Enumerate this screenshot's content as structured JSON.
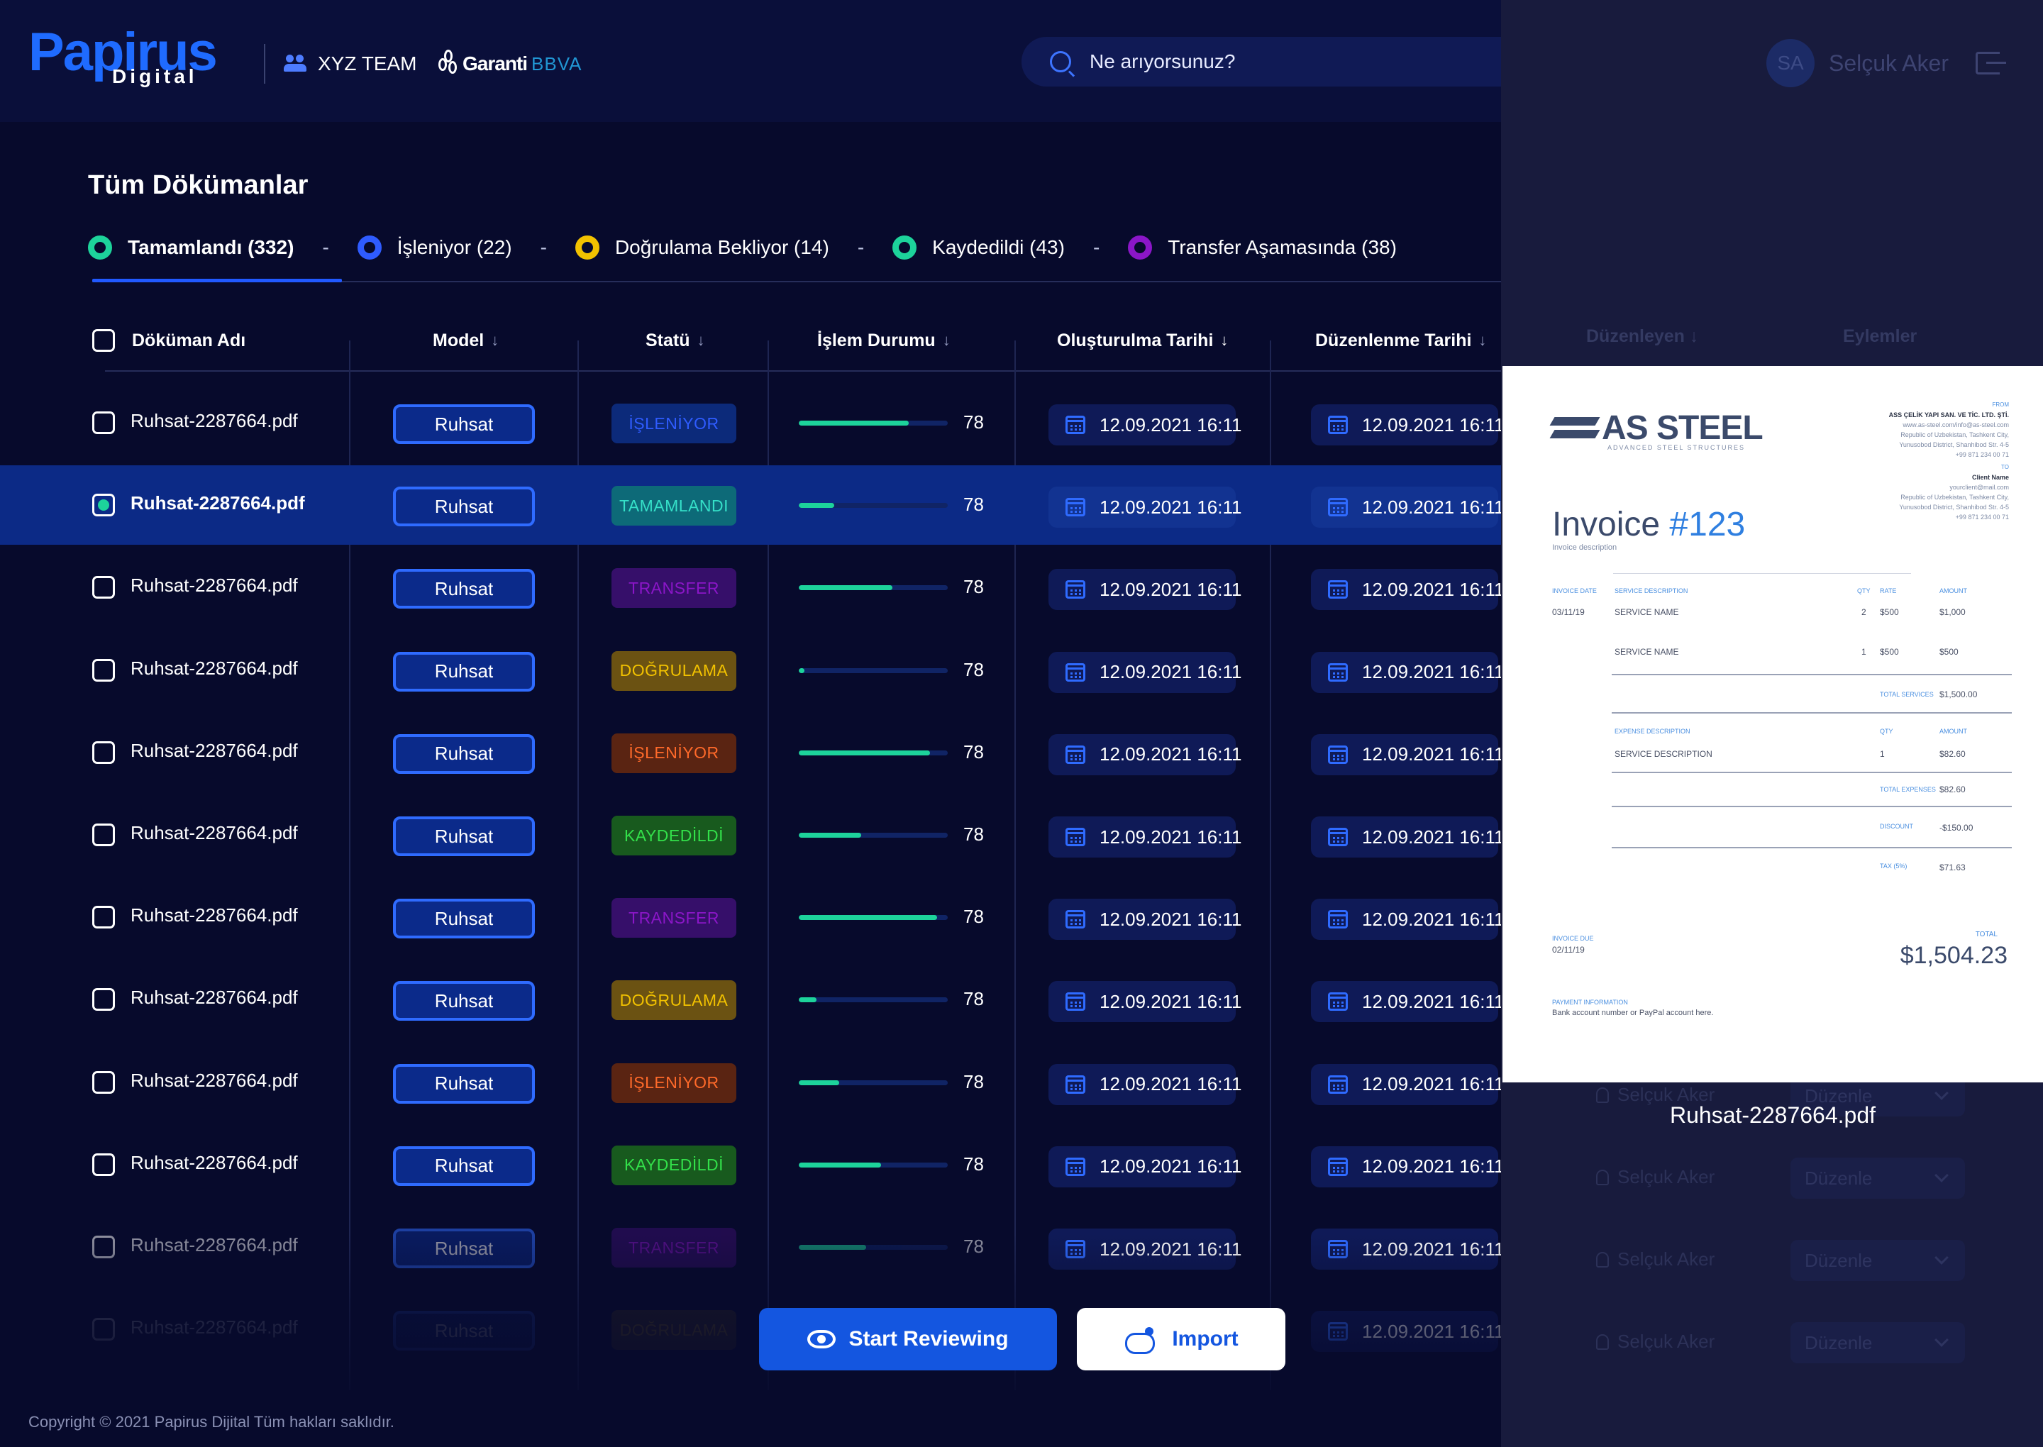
{
  "header": {
    "logo": {
      "main": "Papirus",
      "sub": "Digital"
    },
    "team": "XYZ TEAM",
    "bank": {
      "name": "Garanti",
      "suffix": "BBVA"
    },
    "search_placeholder": "Ne arıyorsunuz?",
    "user": {
      "initials": "SA",
      "name": "Selçuk Aker"
    }
  },
  "page": {
    "title": "Tüm Dökümanlar",
    "tabs": [
      {
        "label": "Tamamlandı (332)",
        "color": "#1dd39b"
      },
      {
        "label": "İşleniyor (22)",
        "color": "#2f5cff"
      },
      {
        "label": "Doğrulama Bekliyor (14)",
        "color": "#f2c200"
      },
      {
        "label": "Kaydedildi (43)",
        "color": "#1dd39b"
      },
      {
        "label": "Transfer Aşamasında (38)",
        "color": "#8b16c8"
      }
    ],
    "tab_separator": "-"
  },
  "table": {
    "columns": [
      "Döküman Adı",
      "Model",
      "Statü",
      "İşlem Durumu",
      "Oluşturulma Tarihi",
      "Düzenlenme Tarihi",
      "Düzenleyen",
      "Eylemler"
    ],
    "sort_glyph": "↓",
    "rows": [
      {
        "name": "Ruhsat-2287664.pdf",
        "model": "Ruhsat",
        "status": "İŞLENİYOR",
        "status_key": "islenyor-blue",
        "progress": 0.74,
        "progress_value": "78",
        "created": "12.09.2021 16:11",
        "edited": "12.09.2021 16:11",
        "selected": false
      },
      {
        "name": "Ruhsat-2287664.pdf",
        "model": "Ruhsat",
        "status": "TAMAMLANDI",
        "status_key": "tamamlandi",
        "progress": 0.24,
        "progress_value": "78",
        "created": "12.09.2021 16:11",
        "edited": "12.09.2021 16:11",
        "selected": true
      },
      {
        "name": "Ruhsat-2287664.pdf",
        "model": "Ruhsat",
        "status": "TRANSFER",
        "status_key": "transfer",
        "progress": 0.63,
        "progress_value": "78",
        "created": "12.09.2021 16:11",
        "edited": "12.09.2021 16:11",
        "selected": false
      },
      {
        "name": "Ruhsat-2287664.pdf",
        "model": "Ruhsat",
        "status": "DOĞRULAMA",
        "status_key": "dogrulama",
        "progress": 0.04,
        "progress_value": "78",
        "created": "12.09.2021 16:11",
        "edited": "12.09.2021 16:11",
        "selected": false
      },
      {
        "name": "Ruhsat-2287664.pdf",
        "model": "Ruhsat",
        "status": "İŞLENİYOR",
        "status_key": "islenyor",
        "progress": 0.88,
        "progress_value": "78",
        "created": "12.09.2021 16:11",
        "edited": "12.09.2021 16:11",
        "selected": false
      },
      {
        "name": "Ruhsat-2287664.pdf",
        "model": "Ruhsat",
        "status": "KAYDEDİLDİ",
        "status_key": "kaydedildi",
        "progress": 0.42,
        "progress_value": "78",
        "created": "12.09.2021 16:11",
        "edited": "12.09.2021 16:11",
        "selected": false
      },
      {
        "name": "Ruhsat-2287664.pdf",
        "model": "Ruhsat",
        "status": "TRANSFER",
        "status_key": "transfer",
        "progress": 0.93,
        "progress_value": "78",
        "created": "12.09.2021 16:11",
        "edited": "12.09.2021 16:11",
        "selected": false
      },
      {
        "name": "Ruhsat-2287664.pdf",
        "model": "Ruhsat",
        "status": "DOĞRULAMA",
        "status_key": "dogrulama",
        "progress": 0.12,
        "progress_value": "78",
        "created": "12.09.2021 16:11",
        "edited": "12.09.2021 16:11",
        "selected": false
      },
      {
        "name": "Ruhsat-2287664.pdf",
        "model": "Ruhsat",
        "status": "İŞLENİYOR",
        "status_key": "islenyor",
        "progress": 0.27,
        "progress_value": "78",
        "created": "12.09.2021 16:11",
        "edited": "12.09.2021 16:11",
        "selected": false
      },
      {
        "name": "Ruhsat-2287664.pdf",
        "model": "Ruhsat",
        "status": "KAYDEDİLDİ",
        "status_key": "kaydedildi",
        "progress": 0.55,
        "progress_value": "78",
        "created": "12.09.2021 16:11",
        "edited": "12.09.2021 16:11",
        "selected": false
      },
      {
        "name": "Ruhsat-2287664.pdf",
        "model": "Ruhsat",
        "status": "TRANSFER",
        "status_key": "transfer",
        "progress": 0.45,
        "progress_value": "78",
        "created": "12.09.2021 16:11",
        "edited": "12.09.2021 16:11",
        "selected": false
      },
      {
        "name": "Ruhsat-2287664.pdf",
        "model": "Ruhsat",
        "status": "DOĞRULAMA",
        "status_key": "dogrulama",
        "progress": 0.0,
        "progress_value": "",
        "created": "",
        "edited": "12.09.2021 16:11",
        "selected": false
      }
    ],
    "editor_name": "Selçuk Aker",
    "action_select": "Düzenle"
  },
  "status_styles": {
    "islenyor-blue": {
      "bg": "#0c2a7a",
      "fg": "#2f5cff"
    },
    "tamamlandi": {
      "bg": "#0d6a78",
      "fg": "#35e0c8"
    },
    "transfer": {
      "bg": "#360f6a",
      "fg": "#8b16c8"
    },
    "dogrulama": {
      "bg": "#6b5212",
      "fg": "#f2c200"
    },
    "islenyor": {
      "bg": "#5a2412",
      "fg": "#ff6a2a"
    },
    "kaydedildi": {
      "bg": "#185a1e",
      "fg": "#33e04a"
    }
  },
  "preview": {
    "file_name": "Ruhsat-2287664.pdf",
    "company": "AS STEEL",
    "company_tag": "ADVANCED STEEL STRUCTURES",
    "from_label": "FROM",
    "from_lines": [
      "ASS ÇELİK YAPI SAN. VE TİC. LTD. ŞTİ.",
      "www.as-steel.com/info@as-steel.com",
      "Republic of Uzbekistan, Tashkent City,",
      "Yunusobod District, Shanhibod Str. 4-5",
      "+99 871 234 00 71"
    ],
    "to_label": "TO",
    "to_lines": [
      "Client Name",
      "yourclient@mail.com",
      "Republic of Uzbekistan, Tashkent City,",
      "Yunusobod District, Shanhibod Str. 4-5",
      "+99 871 234 00 71"
    ],
    "title_prefix": "Invoice ",
    "title_number": "#123",
    "description": "Invoice description",
    "head_labels": [
      "INVOICE DATE",
      "SERVICE DESCRIPTION",
      "QTY",
      "RATE",
      "AMOUNT"
    ],
    "invoice_date": "03/11/19",
    "services": [
      {
        "name": "SERVICE NAME",
        "qty": "2",
        "rate": "$500",
        "amount": "$1,000"
      },
      {
        "name": "SERVICE NAME",
        "qty": "1",
        "rate": "$500",
        "amount": "$500"
      }
    ],
    "total_services_label": "TOTAL SERVICES",
    "total_services": "$1,500.00",
    "expense_labels": [
      "EXPENSE DESCRIPTION",
      "QTY",
      "AMOUNT"
    ],
    "expense": {
      "name": "SERVICE DESCRIPTION",
      "qty": "1",
      "amount": "$82.60"
    },
    "total_expenses_label": "TOTAL EXPENSES",
    "total_expenses": "$82.60",
    "discount_label": "DISCOUNT",
    "discount": "-$150.00",
    "tax_label": "TAX (5%)",
    "tax": "$71.63",
    "due_label": "INVOICE DUE",
    "due_date": "02/11/19",
    "total_label": "TOTAL",
    "total": "$1,504.23",
    "payment_label": "PAYMENT INFORMATION",
    "payment_text": "Bank account number or PayPal account here."
  },
  "actions": {
    "review": "Start Reviewing",
    "import": "Import"
  },
  "footer": {
    "copyright": "Copyright © 2021 Papirus Dijital Tüm hakları saklıdır."
  }
}
